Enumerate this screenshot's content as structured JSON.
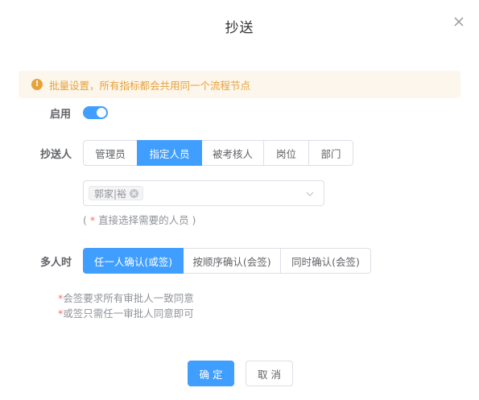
{
  "dialog": {
    "title": "抄送"
  },
  "alert": {
    "text": "批量设置，所有指标都会共用同一个流程节点",
    "icon": "warning-icon",
    "color": "#e6a23c"
  },
  "enable": {
    "label": "启用",
    "on": true
  },
  "cc": {
    "label": "抄送人",
    "tabs": [
      "管理员",
      "指定人员",
      "被考核人",
      "岗位",
      "部门"
    ],
    "selected_tab": "指定人员",
    "select_tag": "郭家|裕",
    "hint_prefix": "( ",
    "hint_star": "*",
    "hint_text": " 直接选择需要的人员 )"
  },
  "multi": {
    "label": "多人时",
    "options": [
      "任一人确认(或签)",
      "按顺序确认(会签)",
      "同时确认(会签)"
    ],
    "selected": "任一人确认(或签)"
  },
  "notes": [
    {
      "star": "*",
      "text": "会签要求所有审批人一致同意"
    },
    {
      "star": "*",
      "text": "或签只需任一审批人同意即可"
    }
  ],
  "footer": {
    "confirm": "确 定",
    "cancel": "取 消"
  },
  "colors": {
    "primary": "#409eff",
    "danger": "#f56c6c",
    "warning": "#e6a23c"
  }
}
